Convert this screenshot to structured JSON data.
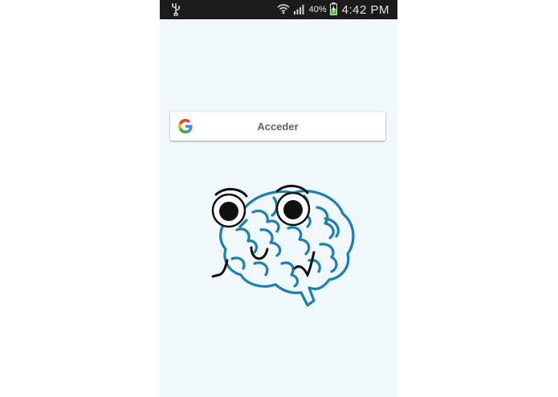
{
  "statusbar": {
    "battery_percent": "40%",
    "time": "4:42 PM",
    "icons": [
      "usb-icon",
      "wifi-icon",
      "signal-icon",
      "battery-charging-icon"
    ]
  },
  "signin": {
    "label": "Acceder",
    "icon": "google-g-icon"
  },
  "mascot": {
    "icon": "brain-mascot-icon",
    "color": "#1a7fb5"
  },
  "colors": {
    "background": "#f1f8fb",
    "statusbar": "#1b1b1b",
    "button_text": "#5f6368"
  }
}
